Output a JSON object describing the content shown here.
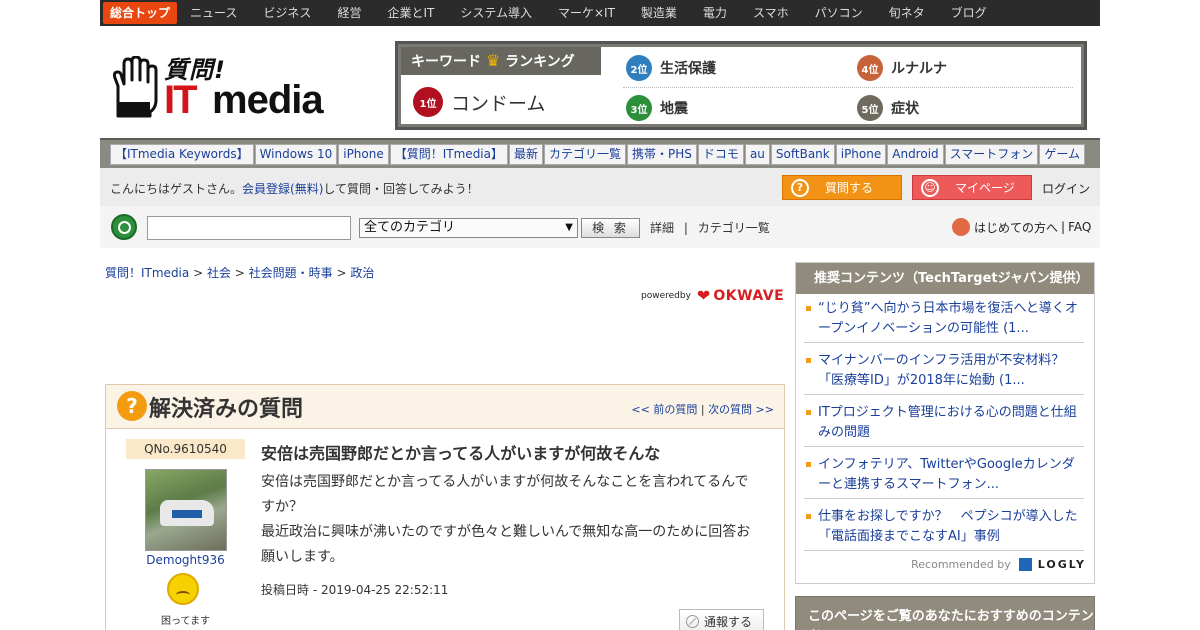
{
  "topnav": {
    "items": [
      "総合トップ",
      "ニュース",
      "ビジネス",
      "経営",
      "企業とIT",
      "システム導入",
      "マーケ×IT",
      "製造業",
      "電力",
      "スマホ",
      "パソコン",
      "旬ネタ",
      "ブログ"
    ]
  },
  "logo": {
    "line1": "質問!",
    "it": "IT",
    "media": "media"
  },
  "ranking": {
    "title": "キーワード",
    "title2": "ランキング",
    "first": {
      "rank": "1位",
      "label": "コンドーム"
    },
    "items": [
      {
        "rank": "2位",
        "label": "生活保護"
      },
      {
        "rank": "3位",
        "label": "地震"
      },
      {
        "rank": "4位",
        "label": "ルナルナ"
      },
      {
        "rank": "5位",
        "label": "症状"
      }
    ],
    "colors": {
      "first": "#b01020",
      "second": "#2f7fbf",
      "third": "#2c8f3a",
      "fourth": "#c8623a",
      "fifth": "#6f6a5e"
    }
  },
  "keywords": [
    "【ITmedia Keywords】",
    "Windows 10",
    "iPhone",
    "【質問！ITmedia】",
    "最新",
    "カテゴリ一覧",
    "携帯・PHS",
    "ドコモ",
    "au",
    "SoftBank",
    "iPhone",
    "Android",
    "スマートフォン",
    "ゲーム"
  ],
  "greeting": {
    "prefix": "こんにちはゲストさん。",
    "link": "会員登録(無料)",
    "suffix": "して質問・回答してみよう！",
    "ask_button": "質問する",
    "mypage_button": "マイページ",
    "login": "ログイン"
  },
  "search": {
    "input_value": "",
    "category_selected": "全てのカテゴリ",
    "button": "検 索",
    "detail": "詳細",
    "separator": "|",
    "category_list": "カテゴリ一覧",
    "first_time": "はじめての方へ",
    "faq": "FAQ"
  },
  "breadcrumb": [
    "質問！ITmedia",
    "社会",
    "社会問題・時事",
    "政治"
  ],
  "powered": {
    "by": "poweredby",
    "brand": "OKWAVE"
  },
  "question": {
    "section_title": "解決済みの質問",
    "prev": "<< 前の質問",
    "next": "次の質問 >>",
    "number": "QNo.9610540",
    "username": "Demoght936",
    "mood": "困ってます",
    "title": "安倍は売国野郎だとか言ってる人がいますが何故そんな",
    "body_lines": [
      "安倍は売国野郎だとか言ってる人がいますが何故そんなことを言われてるんで",
      "すか？",
      "最近政治に興味が沸いたのですが色々と難しいんで無知な高一のために回答お",
      "願いします。"
    ],
    "posted": "投稿日時 - 2019-04-25 22:52:11",
    "report": "通報する"
  },
  "sidebar": {
    "title": "推奨コンテンツ（TechTargetジャパン提供）",
    "items": [
      "“じり貧”へ向かう日本市場を復活へと導くオープンイノベーションの可能性 (1...",
      "マイナンバーのインフラ活用が不安材料？「医療等ID」が2018年に始動 (1...",
      "ITプロジェクト管理における心の問題と仕組みの問題",
      "インフォテリア、TwitterやGoogleカレンダーと連携するスマートフォン...",
      "仕事をお探しですか？　ペプシコが導入した「電話面接までこなすAI」事例"
    ],
    "recommended_by": "Recommended by",
    "logly": "LOGLY",
    "second_title": "このページをご覧のあなたにおすすめのコンテンツ"
  }
}
